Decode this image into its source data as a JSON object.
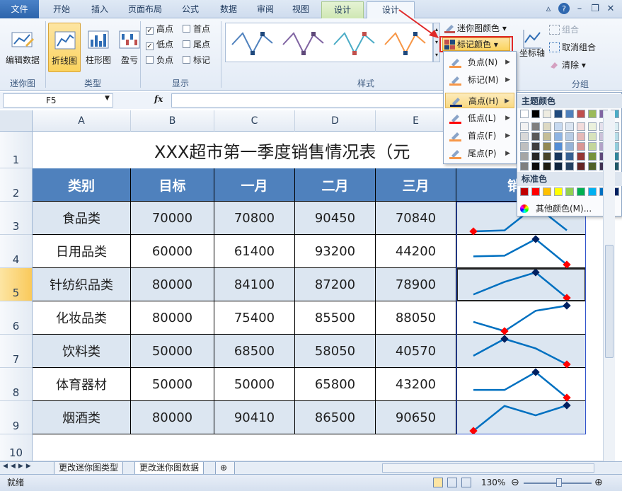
{
  "ribbon": {
    "tabs": [
      "文件",
      "开始",
      "插入",
      "页面布局",
      "公式",
      "数据",
      "审阅",
      "视图",
      "设计",
      "设计"
    ],
    "sparkline_group": {
      "label": "迷你图",
      "edit_data": "编辑数据"
    },
    "type_group": {
      "label": "类型",
      "line": "折线图",
      "column": "柱形图",
      "winloss": "盈亏"
    },
    "show_group": {
      "label": "显示",
      "high": "高点",
      "first": "首点",
      "low": "低点",
      "last": "尾点",
      "negative": "负点",
      "markers": "标记",
      "high_checked": true,
      "low_checked": true,
      "first_checked": false,
      "last_checked": false,
      "negative_checked": false,
      "markers_checked": false
    },
    "style_group": {
      "label": "样式",
      "sparkline_color": "迷你图颜色",
      "marker_color": "标记颜色"
    },
    "axis_button": "坐标轴",
    "group_group": {
      "label": "分组",
      "group": "组合",
      "ungroup": "取消组合",
      "clear": "清除"
    }
  },
  "formula_bar": {
    "name_box": "F5",
    "fx": "fx",
    "formula": ""
  },
  "columns": [
    "A",
    "B",
    "C",
    "D",
    "E"
  ],
  "rows": [
    "1",
    "2",
    "3",
    "4",
    "5",
    "6",
    "7",
    "8",
    "9",
    "10"
  ],
  "sheet": {
    "title": "XXX超市第一季度销售情况表（元",
    "headers": [
      "类别",
      "目标",
      "一月",
      "二月",
      "三月",
      "销量"
    ],
    "data": [
      [
        "食品类",
        "70000",
        "70800",
        "90450",
        "70840"
      ],
      [
        "日用品类",
        "60000",
        "61400",
        "93200",
        "44200"
      ],
      [
        "针纺织品类",
        "80000",
        "84100",
        "87200",
        "78900"
      ],
      [
        "化妆品类",
        "80000",
        "75400",
        "85500",
        "88050"
      ],
      [
        "饮料类",
        "50000",
        "68500",
        "58050",
        "40570"
      ],
      [
        "体育器材",
        "50000",
        "50000",
        "65800",
        "43200"
      ],
      [
        "烟酒类",
        "80000",
        "90410",
        "86500",
        "90650"
      ]
    ]
  },
  "marker_menu": {
    "items": [
      "负点(N)",
      "标记(M)",
      "高点(H)",
      "低点(L)",
      "首点(F)",
      "尾点(P)"
    ],
    "highlighted": "高点(H)"
  },
  "palette": {
    "theme_title": "主题颜色",
    "standard_title": "标准色",
    "more_colors": "其他颜色(M)...",
    "theme_top": [
      "#ffffff",
      "#000000",
      "#eeece1",
      "#1f497d",
      "#4f81bd",
      "#c0504d",
      "#9bbb59",
      "#8064a2",
      "#4bacc6"
    ],
    "theme_shades": [
      [
        "#f2f2f2",
        "#7f7f7f",
        "#ddd9c3",
        "#c6d9f0",
        "#dbe5f1",
        "#f2dcdb",
        "#ebf1dd",
        "#e5e0ec",
        "#dbeef3"
      ],
      [
        "#d8d8d8",
        "#595959",
        "#c4bd97",
        "#8db3e2",
        "#b8cce4",
        "#e5b9b7",
        "#d7e3bc",
        "#ccc1d9",
        "#b7dde8"
      ],
      [
        "#bfbfbf",
        "#3f3f3f",
        "#938953",
        "#548dd4",
        "#95b3d7",
        "#d99694",
        "#c3d69b",
        "#b2a2c7",
        "#92cddc"
      ],
      [
        "#a5a5a5",
        "#262626",
        "#494429",
        "#17365d",
        "#366092",
        "#953734",
        "#76923c",
        "#5f497a",
        "#31859b"
      ],
      [
        "#7f7f7f",
        "#0c0c0c",
        "#1d1b10",
        "#0f243e",
        "#244061",
        "#632423",
        "#4f6128",
        "#3f3151",
        "#205867"
      ]
    ],
    "standard": [
      "#c00000",
      "#ff0000",
      "#ffc000",
      "#ffff00",
      "#92d050",
      "#00b050",
      "#00b0f0",
      "#0070c0",
      "#002060"
    ]
  },
  "sheet_tabs": [
    "更改迷你图类型",
    "更改迷你图数据"
  ],
  "status": {
    "ready": "就绪",
    "zoom": "130%"
  },
  "colors": {
    "header_blue": "#4f81bd",
    "row_band": "#dce6f1",
    "sparkline": "#0070c0",
    "high_marker": "#002060",
    "low_marker": "#ff0000"
  }
}
